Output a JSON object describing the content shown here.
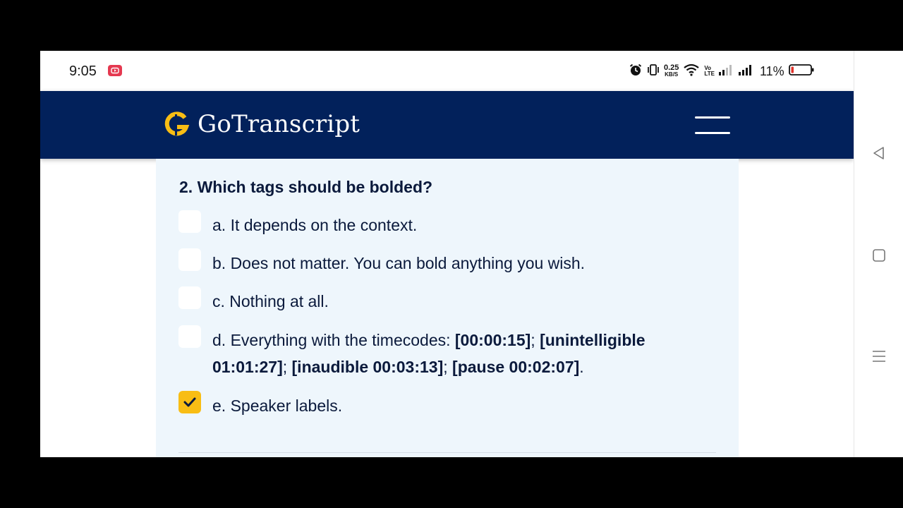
{
  "status_bar": {
    "time": "9:05",
    "net_speed_value": "0.25",
    "net_speed_unit": "KB/S",
    "volte_top": "Vo",
    "volte_bottom": "LTE",
    "battery_percent": "11%"
  },
  "header": {
    "brand": "GoTranscript",
    "brand_color": "#02215b",
    "logo_color": "#f8bd14"
  },
  "quiz": {
    "question": "2. Which tags should be bolded?",
    "options": [
      {
        "label": "a. It depends on the context.",
        "checked": false
      },
      {
        "label": "b. Does not matter. You can bold anything you wish.",
        "checked": false
      },
      {
        "label": "c. Nothing at all.",
        "checked": false
      },
      {
        "prefix": "d. Everything with the timecodes: ",
        "tag1": "[00:00:15]",
        "sep1": "; ",
        "tag2": "[unintelligible 01:01:27]",
        "sep2": "; ",
        "tag3": "[inaudible 00:03:13]",
        "sep3": "; ",
        "tag4": "[pause 00:02:07]",
        "end": ".",
        "checked": false
      },
      {
        "label": "e. Speaker labels.",
        "checked": true
      }
    ]
  },
  "icons": {
    "notification": "youtube-icon",
    "alarm": "alarm-icon",
    "vibrate": "vibrate-icon",
    "wifi": "wifi-icon",
    "signal": "signal-icon",
    "battery": "battery-icon",
    "menu": "hamburger-menu-icon",
    "check": "check-icon",
    "nav_back": "back-triangle-icon",
    "nav_home": "home-square-icon",
    "nav_recents": "recents-menu-icon"
  }
}
